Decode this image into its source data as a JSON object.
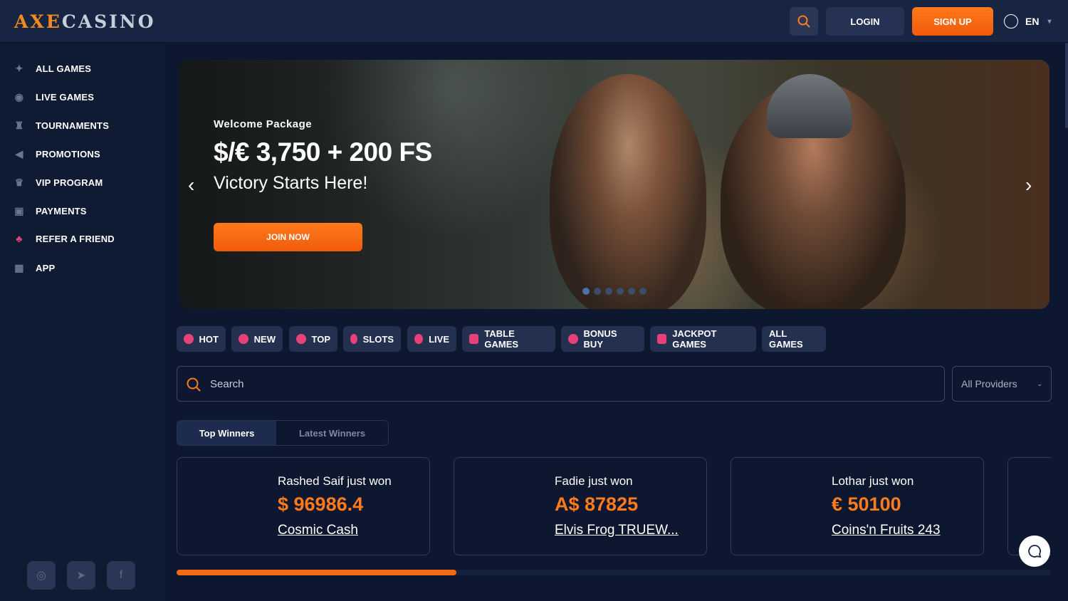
{
  "brand": {
    "logo_left": "AXE",
    "logo_right": "CASINO"
  },
  "header": {
    "login": "LOGIN",
    "signup": "SIGN UP",
    "language": "EN",
    "accent": "#f36a14"
  },
  "sidebar": {
    "items": [
      {
        "label": "ALL GAMES",
        "icon": "grid-sparkle-icon"
      },
      {
        "label": "LIVE GAMES",
        "icon": "roulette-icon"
      },
      {
        "label": "TOURNAMENTS",
        "icon": "trophy-icon"
      },
      {
        "label": "PROMOTIONS",
        "icon": "megaphone-icon"
      },
      {
        "label": "VIP PROGRAM",
        "icon": "crown-icon"
      },
      {
        "label": "PAYMENTS",
        "icon": "wallet-icon"
      },
      {
        "label": "REFER A FRIEND",
        "icon": "users-icon"
      },
      {
        "label": "APP",
        "icon": "apps-icon"
      }
    ],
    "social": [
      "instagram-icon",
      "telegram-icon",
      "facebook-icon"
    ]
  },
  "hero": {
    "kicker": "Welcome Package",
    "title": "$/€ 3,750 + 200 FS",
    "subtitle": "Victory Starts Here!",
    "cta": "JOIN NOW",
    "slide_count": 6,
    "active_slide": 1
  },
  "categories": [
    "HOT",
    "NEW",
    "TOP",
    "SLOTS",
    "LIVE",
    "TABLE GAMES",
    "BONUS BUY",
    "JACKPOT GAMES",
    "ALL GAMES"
  ],
  "search": {
    "placeholder": "Search",
    "providers": "All Providers"
  },
  "winners": {
    "tabs": [
      "Top Winners",
      "Latest Winners"
    ],
    "cards": [
      {
        "name": "Rashed Saif just won",
        "amount": "$ 96986.4",
        "game": "Cosmic Cash"
      },
      {
        "name": "Fadie just won",
        "amount": "A$ 87825",
        "game": "Elvis Frog TRUEW..."
      },
      {
        "name": "Lothar just won",
        "amount": "€ 50100",
        "game": "Coins'n Fruits 243"
      }
    ],
    "progress": 0.32
  }
}
